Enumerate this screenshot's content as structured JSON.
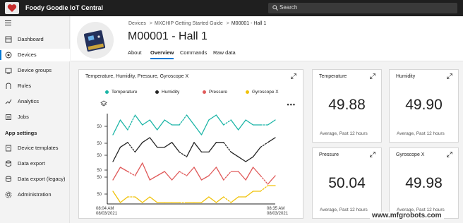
{
  "app": {
    "title": "Foody Goodie IoT Central"
  },
  "search": {
    "placeholder": "Search"
  },
  "sidebar": {
    "items": [
      {
        "label": "Dashboard",
        "icon": "dashboard-icon"
      },
      {
        "label": "Devices",
        "icon": "devices-icon",
        "active": true
      },
      {
        "label": "Device groups",
        "icon": "device-groups-icon"
      },
      {
        "label": "Rules",
        "icon": "rules-icon"
      },
      {
        "label": "Analytics",
        "icon": "analytics-icon"
      },
      {
        "label": "Jobs",
        "icon": "jobs-icon"
      }
    ],
    "section_label": "App settings",
    "settings_items": [
      {
        "label": "Device templates",
        "icon": "device-templates-icon"
      },
      {
        "label": "Data export",
        "icon": "data-export-icon"
      },
      {
        "label": "Data export (legacy)",
        "icon": "data-export-legacy-icon"
      },
      {
        "label": "Administration",
        "icon": "administration-icon"
      }
    ]
  },
  "breadcrumb": [
    "Devices",
    "MXCHIP Getting Started Guide",
    "M00001 - Hall 1"
  ],
  "page_title": "M00001 - Hall 1",
  "tabs": [
    {
      "label": "About"
    },
    {
      "label": "Overview",
      "active": true
    },
    {
      "label": "Commands"
    },
    {
      "label": "Raw data"
    }
  ],
  "chart_tile": {
    "title": "Temperature, Humidity, Pressure, Gyroscope X",
    "x_start": "08:04 AM",
    "x_start_date": "08/03/2021",
    "x_end": "08:35 AM",
    "x_end_date": "08/03/2021"
  },
  "chart_data": {
    "type": "line",
    "title": "Temperature, Humidity, Pressure, Gyroscope X",
    "layout": "stacked-panels",
    "x": [
      "08:04 AM",
      "08:35 AM"
    ],
    "legend_position": "top",
    "series": [
      {
        "name": "Temperature",
        "color": "#1bb5a6",
        "tick_labels": [
          "50"
        ],
        "values": [
          49.6,
          49.9,
          49.7,
          50.0,
          49.8,
          49.9,
          49.7,
          49.9,
          49.8,
          49.8,
          50.0,
          49.8,
          49.6,
          49.9,
          50.0,
          49.8,
          49.9,
          49.7,
          49.9,
          49.8,
          49.8,
          49.8,
          49.9
        ]
      },
      {
        "name": "Humidity",
        "color": "#252525",
        "tick_labels": [
          "50",
          "50"
        ],
        "values": [
          49.6,
          49.9,
          50.0,
          49.8,
          50.0,
          50.1,
          49.9,
          49.9,
          50.0,
          49.8,
          49.7,
          50.0,
          49.8,
          49.8,
          50.0,
          50.0,
          49.8,
          49.7,
          49.6,
          49.7,
          49.9,
          50.0,
          50.1
        ]
      },
      {
        "name": "Pressure",
        "color": "#e05a5a",
        "tick_labels": [
          "50",
          "50"
        ],
        "values": [
          49.7,
          50.0,
          49.9,
          49.8,
          50.1,
          49.7,
          49.8,
          49.9,
          49.7,
          49.9,
          49.8,
          50.0,
          49.7,
          49.8,
          50.0,
          49.7,
          49.9,
          49.9,
          49.7,
          50.0,
          49.8,
          49.6,
          49.8
        ]
      },
      {
        "name": "Gyroscope X",
        "color": "#f0c20a",
        "tick_labels": [
          "50"
        ],
        "values": [
          50.0,
          49.8,
          49.9,
          49.9,
          49.8,
          49.9,
          49.8,
          49.8,
          49.8,
          49.8,
          49.8,
          49.8,
          49.8,
          49.9,
          49.8,
          49.9,
          49.8,
          49.9,
          49.9,
          50.0,
          50.0,
          50.1,
          50.1
        ]
      }
    ]
  },
  "kpis": [
    {
      "title": "Temperature",
      "value": "49.88",
      "sub": "Average, Past 12 hours"
    },
    {
      "title": "Humidity",
      "value": "49.90",
      "sub": "Average, Past 12 hours"
    },
    {
      "title": "Pressure",
      "value": "50.04",
      "sub": "Average, Past 12 hours"
    },
    {
      "title": "Gyroscope X",
      "value": "49.98",
      "sub": "Average, Past 12 hours"
    }
  ],
  "watermark": "www.mfgrobots.com",
  "colors": {
    "accent": "#0078d4",
    "topbar": "#1f1f1f"
  }
}
